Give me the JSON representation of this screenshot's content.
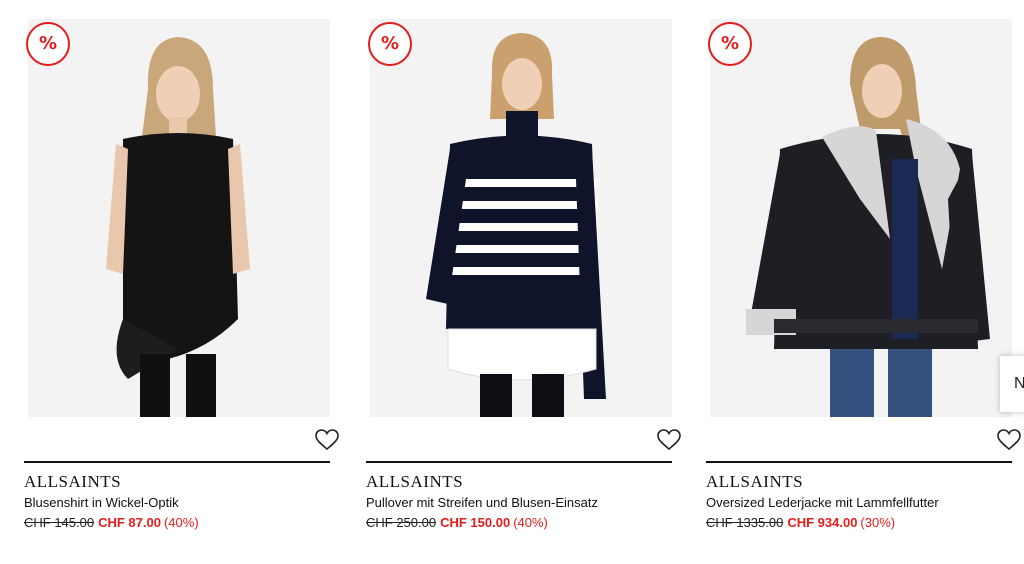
{
  "accent_color": "#e31c1c",
  "products": [
    {
      "badge": "%",
      "brand": "ALLSAINTS",
      "name": "Blusenshirt in Wickel-Optik",
      "old_price": "CHF 145.00",
      "new_price": "CHF 87.00",
      "discount": "(40%)",
      "wishlist_icon": "heart-outline-icon"
    },
    {
      "badge": "%",
      "brand": "ALLSAINTS",
      "name": "Pullover mit Streifen und Blusen-Einsatz",
      "old_price": "CHF 250.00",
      "new_price": "CHF 150.00",
      "discount": "(40%)",
      "wishlist_icon": "heart-outline-icon"
    },
    {
      "badge": "%",
      "brand": "ALLSAINTS",
      "name": "Oversized Lederjacke mit Lammfellfutter",
      "old_price": "CHF 1335.00",
      "new_price": "CHF 934.00",
      "discount": "(30%)",
      "wishlist_icon": "heart-outline-icon"
    }
  ],
  "carousel": {
    "next_label": "N"
  }
}
